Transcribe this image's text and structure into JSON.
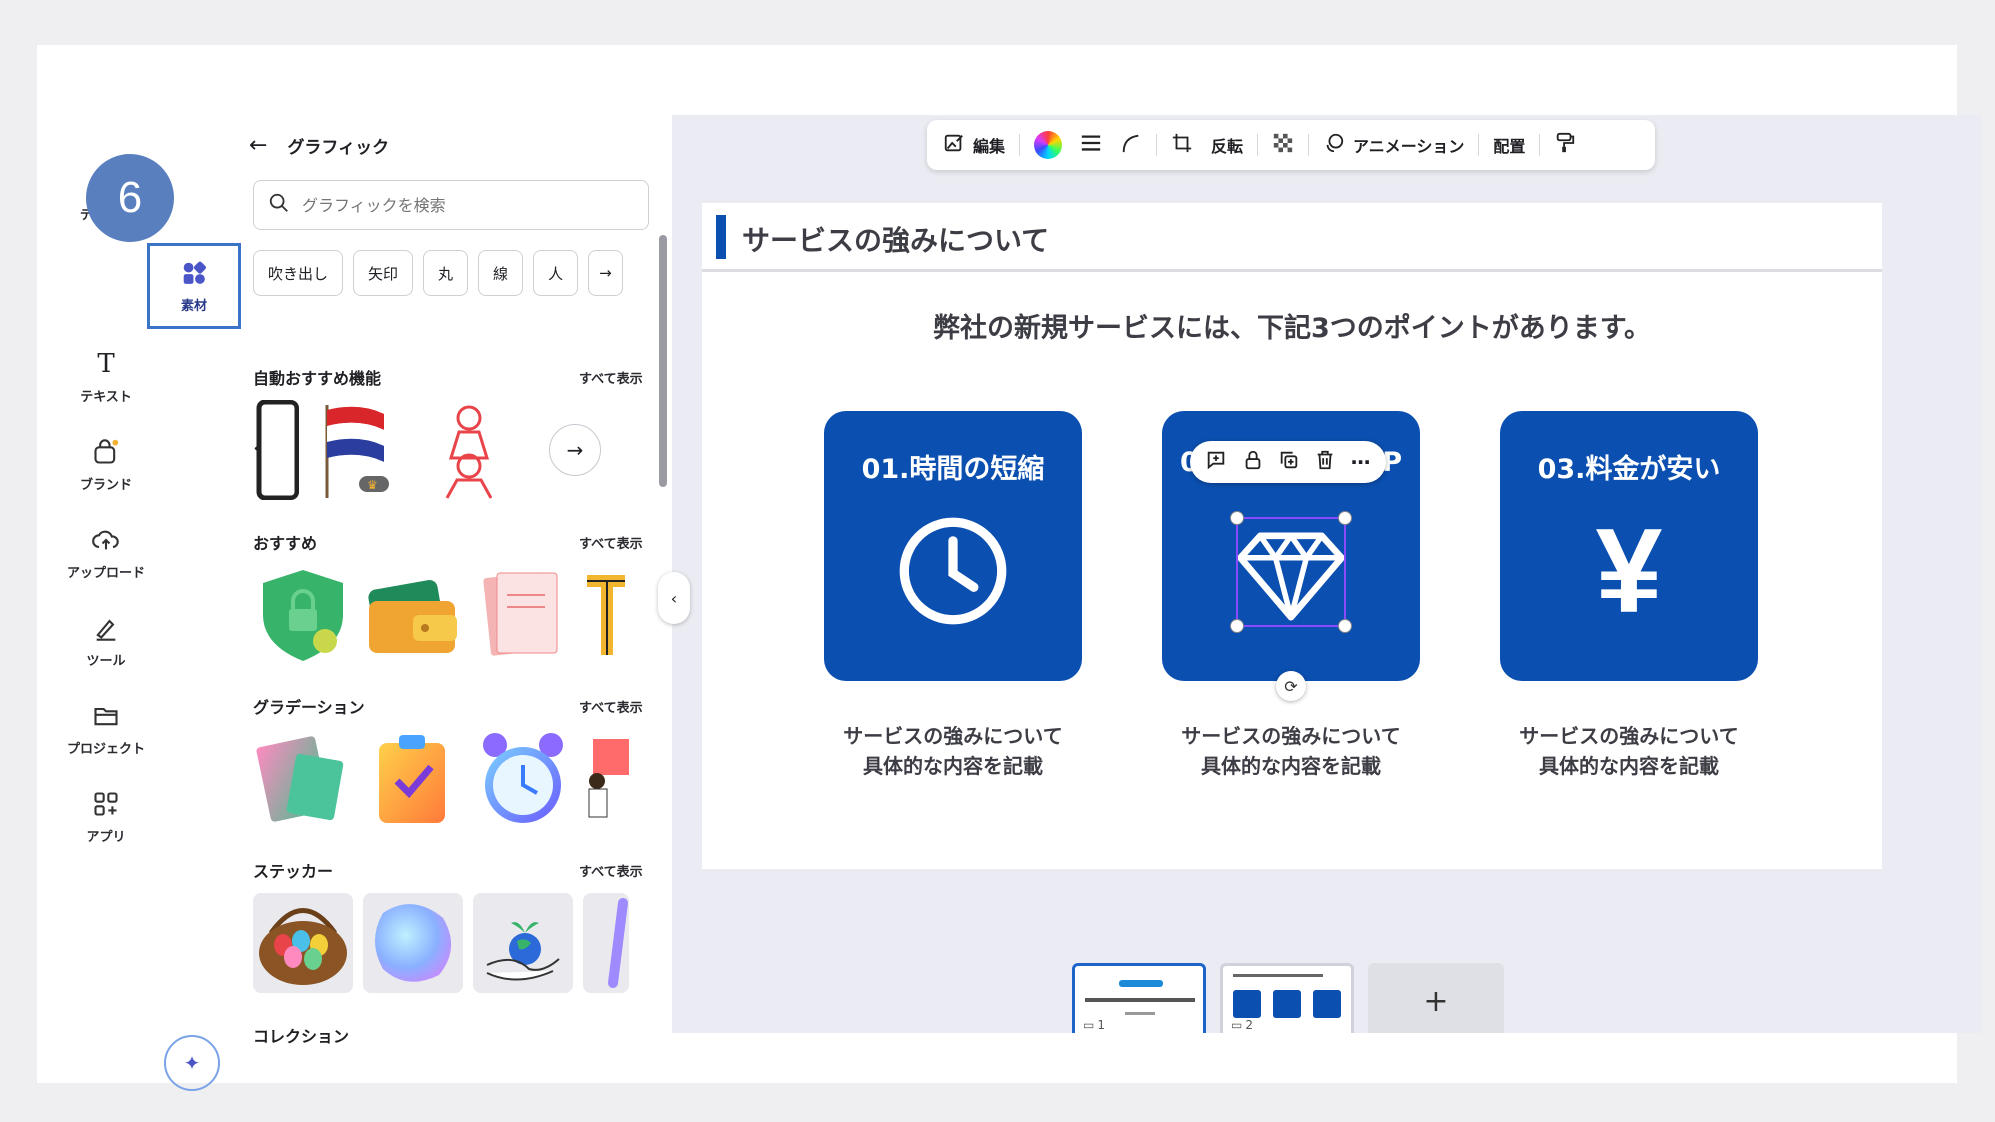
{
  "step_badge": "6",
  "rail": {
    "items": [
      {
        "name": "デザイン",
        "icon": "layout-icon"
      },
      {
        "name": "素材",
        "icon": "elements-icon"
      },
      {
        "name": "テキスト",
        "icon": "text-icon"
      },
      {
        "name": "ブランド",
        "icon": "brand-icon"
      },
      {
        "name": "アップロード",
        "icon": "upload-icon"
      },
      {
        "name": "ツール",
        "icon": "pen-tool-icon"
      },
      {
        "name": "プロジェクト",
        "icon": "folder-icon"
      },
      {
        "name": "アプリ",
        "icon": "apps-icon"
      }
    ]
  },
  "panel": {
    "title": "グラフィック",
    "search_placeholder": "グラフィックを検索",
    "chips": [
      "吹き出し",
      "矢印",
      "丸",
      "線",
      "人"
    ],
    "see_all": "すべて表示",
    "sections": {
      "auto": "自動おすすめ機能",
      "recommended": "おすすめ",
      "gradation": "グラデーション",
      "sticker": "ステッカー",
      "collection": "コレクション"
    }
  },
  "toolbar": {
    "edit": "編集",
    "flip": "反転",
    "animation": "アニメーション",
    "arrange": "配置"
  },
  "slide": {
    "title": "サービスの強みについて",
    "subtitle": "弊社の新規サービスには、下記3つのポイントがあります。",
    "cards": [
      {
        "title": "01.時間の短縮",
        "desc1": "サービスの強みについて",
        "desc2": "具体的な内容を記載"
      },
      {
        "title_prefix": "0",
        "title_suffix": "P",
        "desc1": "サービスの強みについて",
        "desc2": "具体的な内容を記載"
      },
      {
        "title": "03.料金が安い",
        "symbol": "¥",
        "desc1": "サービスの強みについて",
        "desc2": "具体的な内容を記載"
      }
    ]
  },
  "pages": {
    "page1": "1",
    "page2": "2",
    "add": "+"
  },
  "colors": {
    "brand_blue": "#0b4fb0",
    "selection": "#8a4bff",
    "badge": "#5a7fbf"
  }
}
